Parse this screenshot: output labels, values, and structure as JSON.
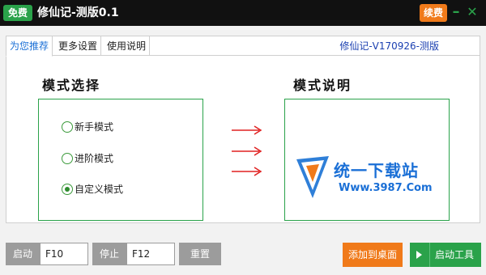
{
  "titlebar": {
    "free_badge": "免费",
    "title": "修仙记-测版0.1",
    "renew_label": "续费",
    "minimize_glyph": "–",
    "close_glyph": "✕"
  },
  "tabs": {
    "items": [
      "为您推荐",
      "更多设置",
      "使用说明"
    ],
    "active_index": 0,
    "version": "修仙记-V170926-测版"
  },
  "left_section": {
    "title": "模式选择",
    "options": [
      "新手模式",
      "进阶模式",
      "自定义模式"
    ],
    "selected_index": 2
  },
  "right_section": {
    "title": "模式说明",
    "logo_main": "统一下载站",
    "logo_sub": "Www.3987.Com"
  },
  "controls": {
    "start_label": "启动",
    "start_hotkey": "F10",
    "stop_label": "停止",
    "stop_hotkey": "F12",
    "reset_label": "重置",
    "add_desktop_label": "添加到桌面",
    "launch_label": "启动工具"
  },
  "colors": {
    "accent_green": "#2aa24a",
    "accent_orange": "#f07a1a",
    "arrow_red": "#e02020",
    "link_blue": "#1a3fb0"
  }
}
